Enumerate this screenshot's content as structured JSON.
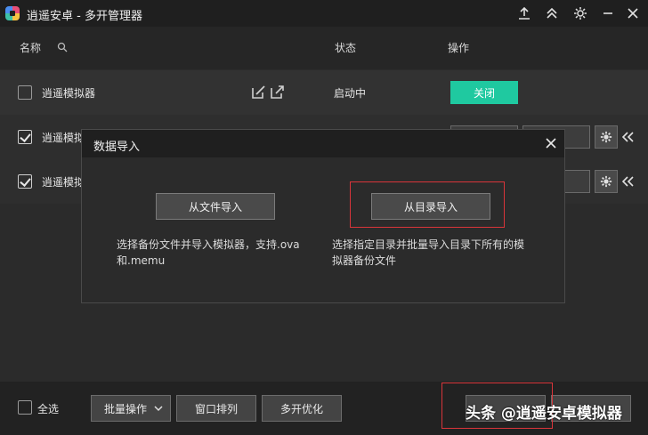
{
  "window": {
    "title": "逍遥安卓 - 多开管理器"
  },
  "header": {
    "name_col": "名称",
    "status_col": "状态",
    "action_col": "操作"
  },
  "rows": [
    {
      "name": "逍遥模拟器",
      "checked": false,
      "status": "启动中",
      "action_label": "关闭"
    },
    {
      "name": "逍遥模拟",
      "checked": true
    },
    {
      "name": "逍遥模拟",
      "checked": true
    }
  ],
  "dialog": {
    "title": "数据导入",
    "file_import_label": "从文件导入",
    "dir_import_label": "从目录导入",
    "file_import_desc": "选择备份文件并导入模拟器，支持.ova和.memu",
    "dir_import_desc": "选择指定目录并批量导入目录下所有的模拟器备份文件"
  },
  "bottom": {
    "select_all": "全选",
    "batch_ops": "批量操作",
    "window_arrange": "窗口排列",
    "multi_optimize": "多开优化"
  },
  "watermark": "头条 @逍遥安卓模拟器",
  "colors": {
    "accent_green": "#1fc9a0",
    "highlight_red": "#d9353a"
  }
}
